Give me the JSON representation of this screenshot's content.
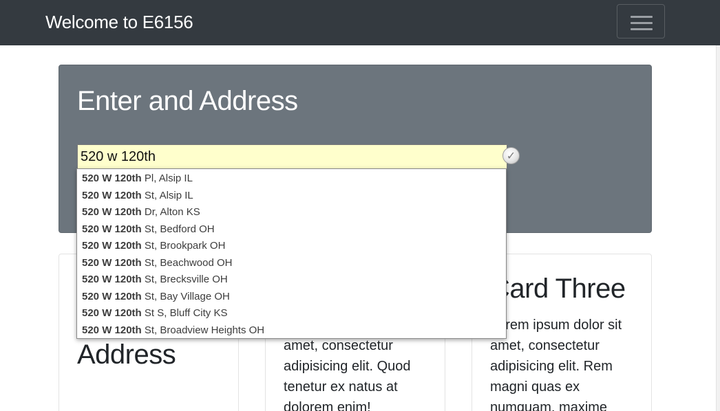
{
  "navbar": {
    "brand": "Welcome to E6156",
    "toggler_icon": "hamburger-icon"
  },
  "jumbotron": {
    "title": "Enter and Address",
    "address_input": {
      "value": "520 w 120th",
      "placeholder": ""
    },
    "validate_icon": "checkmark-icon"
  },
  "autocomplete": {
    "items": [
      {
        "match": "520 W 120th",
        "rest": " Pl, Alsip IL"
      },
      {
        "match": "520 W 120th",
        "rest": " St, Alsip IL"
      },
      {
        "match": "520 W 120th",
        "rest": " Dr, Alton KS"
      },
      {
        "match": "520 W 120th",
        "rest": " St, Bedford OH"
      },
      {
        "match": "520 W 120th",
        "rest": " St, Brookpark OH"
      },
      {
        "match": "520 W 120th",
        "rest": " St, Beachwood OH"
      },
      {
        "match": "520 W 120th",
        "rest": " St, Brecksville OH"
      },
      {
        "match": "520 W 120th",
        "rest": " St, Bay Village OH"
      },
      {
        "match": "520 W 120th",
        "rest": " St S, Bluff City KS"
      },
      {
        "match": "520 W 120th",
        "rest": " St, Broadview Heights OH"
      }
    ]
  },
  "cards": [
    {
      "title": "Address",
      "text": ""
    },
    {
      "title": "",
      "text": "amet, consectetur adipisicing elit. Quod tenetur ex natus at dolorem enim!"
    },
    {
      "title": "Card Three",
      "text": "Lorem ipsum dolor sit amet, consectetur adipisicing elit. Rem magni quas ex numquam, maxime"
    }
  ],
  "colors": {
    "navbar_bg": "#343a40",
    "jumbotron_bg": "#6c757d",
    "input_bg": "#ffffcc"
  }
}
